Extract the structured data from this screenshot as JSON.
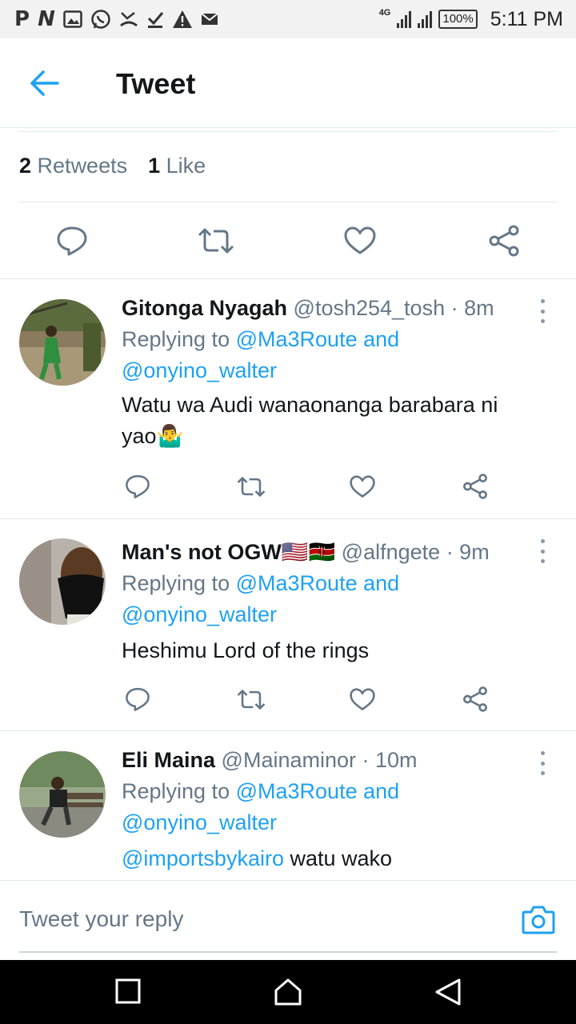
{
  "status_bar": {
    "left_icons": [
      "P",
      "N",
      "gallery-icon",
      "whatsapp-icon",
      "missed-call-icon",
      "download-done-icon",
      "warning-icon",
      "mail-icon"
    ],
    "network": "4G",
    "battery": "100%",
    "time": "5:11 PM"
  },
  "header": {
    "title": "Tweet"
  },
  "stats": {
    "retweets_count": "2",
    "retweets_label": "Retweets",
    "likes_count": "1",
    "likes_label": "Like"
  },
  "replies": [
    {
      "name": "Gitonga Nyagah",
      "handle": "@tosh254_tosh",
      "time": "· 8m",
      "replying_prefix": "Replying to",
      "replying_to": "@Ma3Route and",
      "replying_to_2": "@onyino_walter",
      "text_line1": "Watu wa Audi wanaonanga barabara ni",
      "text_line2": "yao",
      "emoji": "🤷‍♂️"
    },
    {
      "name": "Man's not OGW",
      "flags": "🇺🇸🇰🇪",
      "handle": "@alfngete",
      "time": "· 9m",
      "replying_prefix": "Replying to",
      "replying_to": "@Ma3Route and",
      "replying_to_2": "@onyino_walter",
      "text_line1": "Heshimu Lord of the rings"
    },
    {
      "name": "Eli Maina",
      "handle": "@Mainaminor",
      "time": "· 10m",
      "replying_prefix": "Replying to",
      "replying_to": "@Ma3Route and",
      "replying_to_2": "@onyino_walter",
      "mention": "@importsbykairo",
      "text_line1": "watu wako"
    }
  ],
  "reply_box": {
    "placeholder": "Tweet your reply"
  },
  "colors": {
    "accent": "#1da1f2",
    "secondary_text": "#657786",
    "icon": "#657786"
  }
}
